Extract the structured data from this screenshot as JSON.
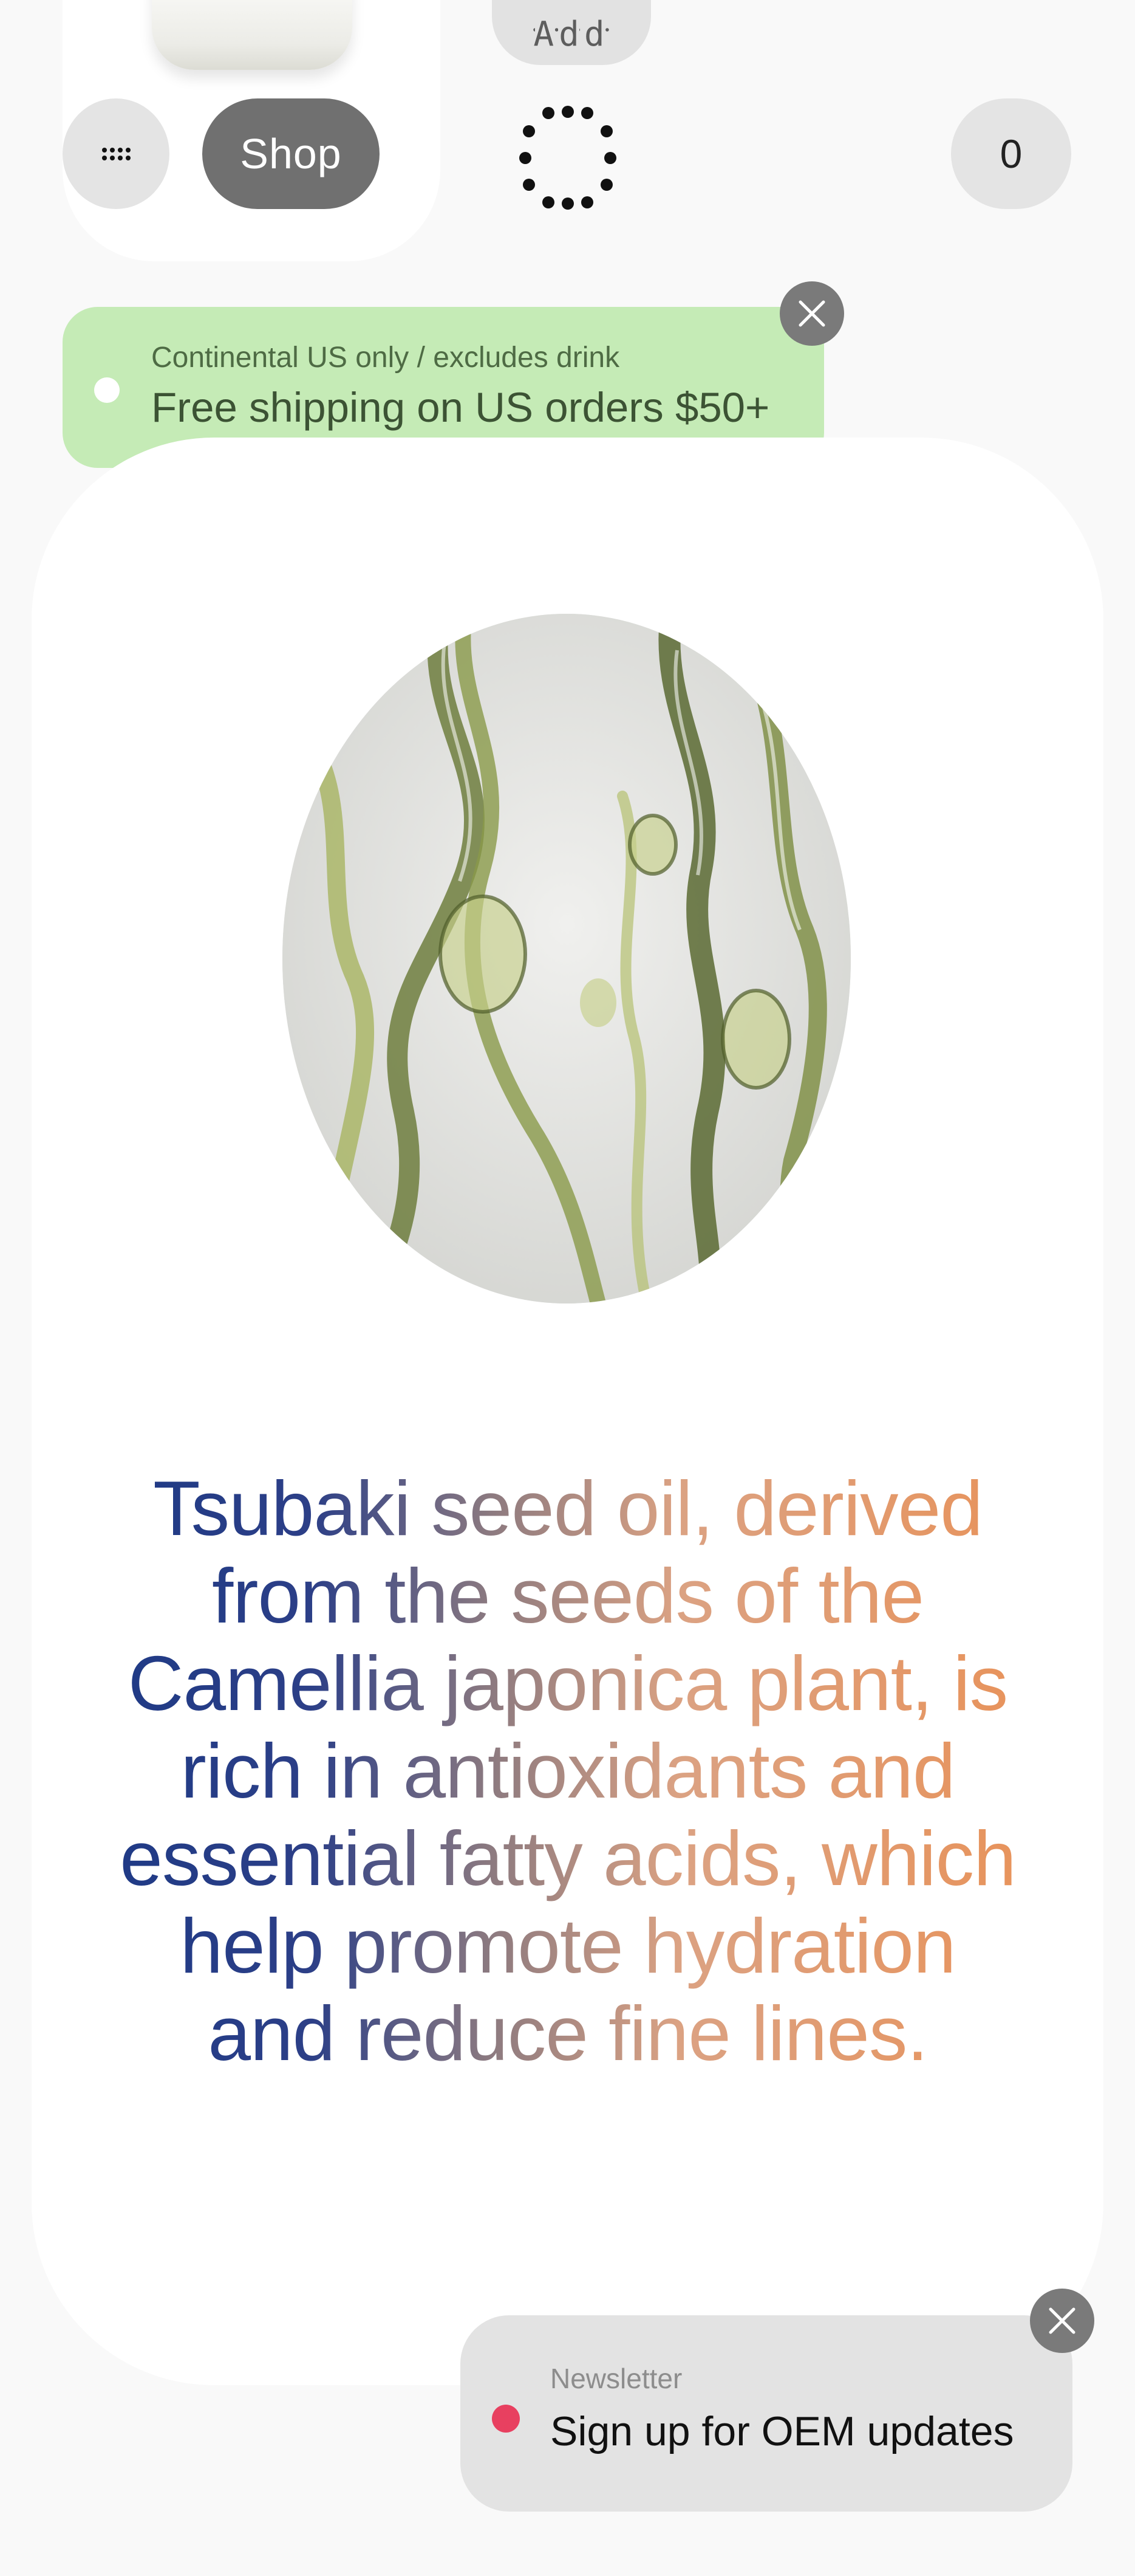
{
  "header": {
    "add_label": "Add",
    "shop_label": "Shop",
    "cart_count": "0",
    "icons": {
      "menu": "grid-menu-icon",
      "logo": "dotted-ring-logo",
      "close": "close-x-icon"
    }
  },
  "shipping_banner": {
    "subtitle": "Continental US only / excludes drink",
    "title": "Free shipping on US orders $50+"
  },
  "hero": {
    "quote": "Tsubaki seed oil, derived from the seeds of the Camellia japonica plant, is rich in antioxidants and essential fatty acids, which help promote hydration and reduce fine lines."
  },
  "newsletter": {
    "label": "Newsletter",
    "title": "Sign up for OEM updates"
  },
  "colors": {
    "banner_green": "#c5ebb6",
    "newsletter_dot": "#e84060",
    "shop_button": "#707070",
    "gradient_start": "#1f3a86",
    "gradient_end": "#e8935b"
  }
}
